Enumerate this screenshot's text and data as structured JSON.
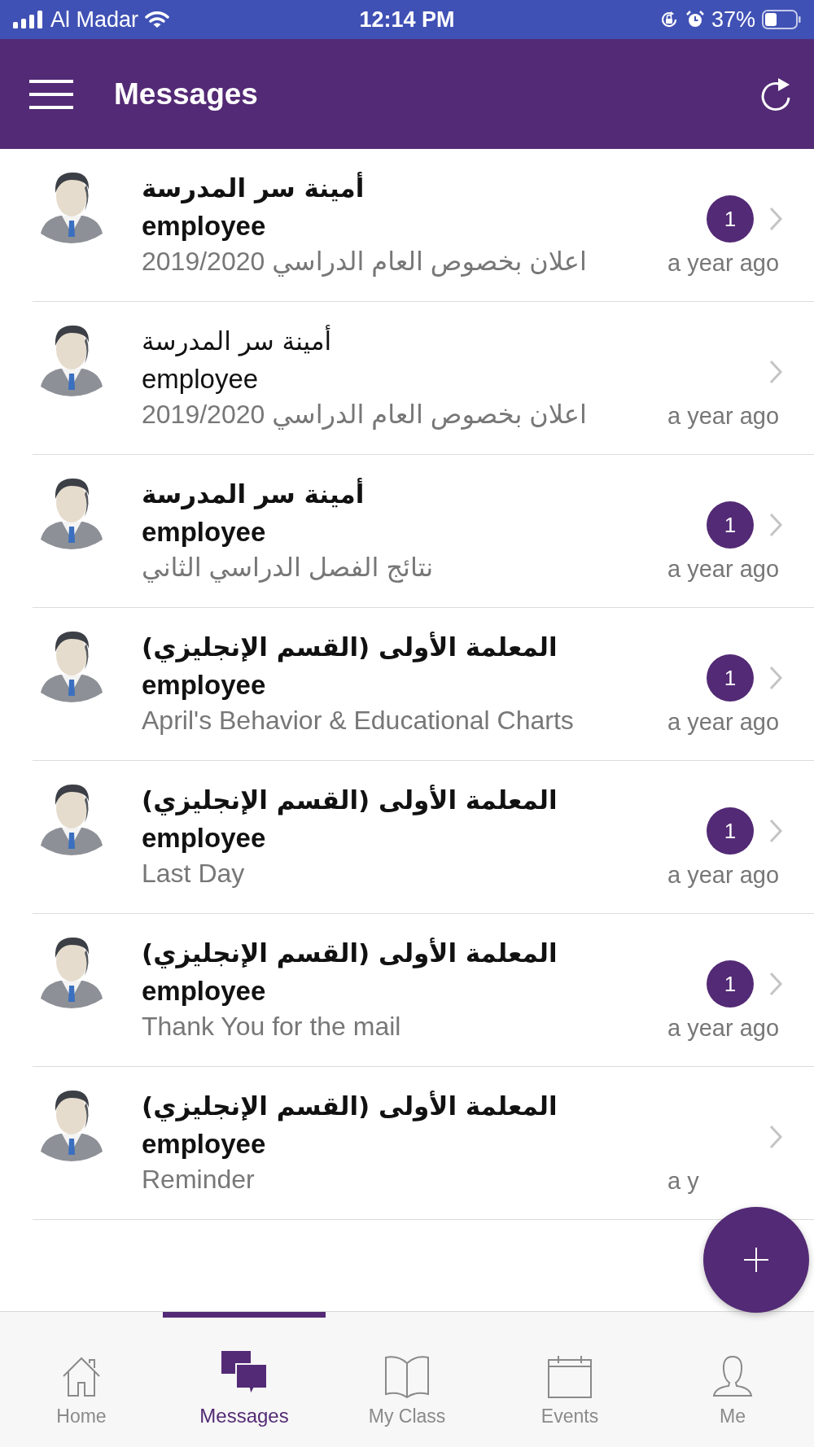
{
  "status_bar": {
    "carrier": "Al Madar",
    "time": "12:14 PM",
    "battery": "37%"
  },
  "header": {
    "title": "Messages"
  },
  "messages": [
    {
      "name": "أمينة سر المدرسة",
      "role": "employee",
      "subject": "اعلان بخصوص العام الدراسي 2019/2020",
      "time": "a year ago",
      "unread": true,
      "badge": "1"
    },
    {
      "name": "أمينة سر المدرسة",
      "role": "employee",
      "subject": "اعلان بخصوص العام الدراسي 2019/2020",
      "time": "a year ago",
      "unread": false
    },
    {
      "name": "أمينة سر المدرسة",
      "role": "employee",
      "subject": "نتائج الفصل الدراسي الثاني",
      "time": "a year ago",
      "unread": true,
      "badge": "1"
    },
    {
      "name": "المعلمة الأولى (القسم الإنجليزي)",
      "role": "employee",
      "subject": "April's Behavior & Educational Charts",
      "time": "a year ago",
      "unread": true,
      "badge": "1"
    },
    {
      "name": "المعلمة الأولى (القسم الإنجليزي)",
      "role": "employee",
      "subject": "Last Day",
      "time": "a year ago",
      "unread": true,
      "badge": "1"
    },
    {
      "name": "المعلمة الأولى (القسم الإنجليزي)",
      "role": "employee",
      "subject": "Thank You for the mail",
      "time": "a year ago",
      "unread": true,
      "badge": "1"
    },
    {
      "name": "المعلمة الأولى (القسم الإنجليزي)",
      "role": "employee",
      "subject": "Reminder",
      "time": "a y",
      "unread": true
    }
  ],
  "tabs": [
    {
      "label": "Home",
      "kind": "home",
      "selected": false
    },
    {
      "label": "Messages",
      "kind": "messages",
      "selected": true
    },
    {
      "label": "My Class",
      "kind": "book",
      "selected": false
    },
    {
      "label": "Events",
      "kind": "calendar",
      "selected": false
    },
    {
      "label": "Me",
      "kind": "person",
      "selected": false
    }
  ]
}
